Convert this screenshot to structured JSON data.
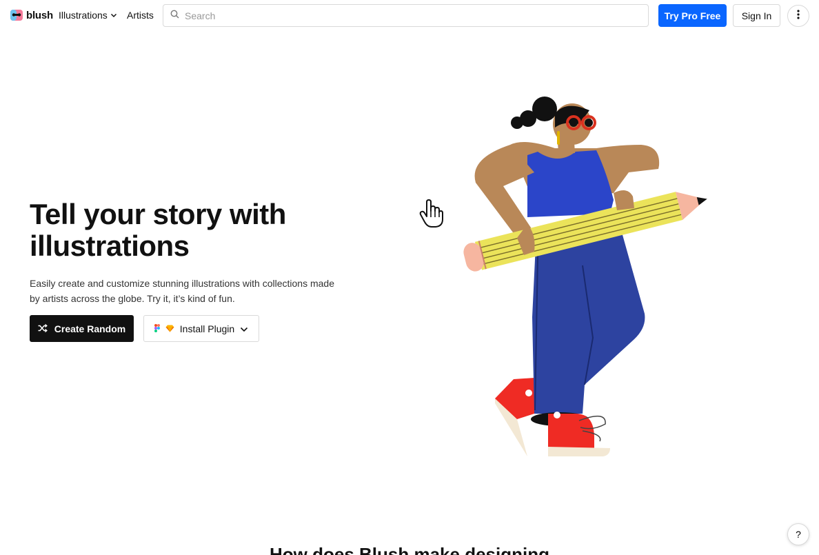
{
  "brand": {
    "name": "blush",
    "logo_icon": "blush-face-logo"
  },
  "nav": {
    "illustrations_label": "Illustrations",
    "artists_label": "Artists"
  },
  "search": {
    "placeholder": "Search",
    "value": ""
  },
  "header_actions": {
    "try_pro_label": "Try Pro Free",
    "sign_in_label": "Sign In",
    "more_icon": "vertical-dots-icon"
  },
  "hero": {
    "title": "Tell your story with illustrations",
    "subtitle": "Easily create and customize stunning illustrations with collections made by artists across the globe. Try it, it’s kind of fun.",
    "create_random_label": "Create Random",
    "install_plugin_label": "Install Plugin"
  },
  "next_section": {
    "title": "How does Blush make designing"
  },
  "help": {
    "label": "?"
  },
  "colors": {
    "accent": "#0a66ff",
    "dark_button": "#111111",
    "shirt": "#2b45c9",
    "pants": "#2d43a0",
    "skin": "#b98858",
    "pencil": "#ebe35a",
    "shoes": "#ef2b24"
  }
}
